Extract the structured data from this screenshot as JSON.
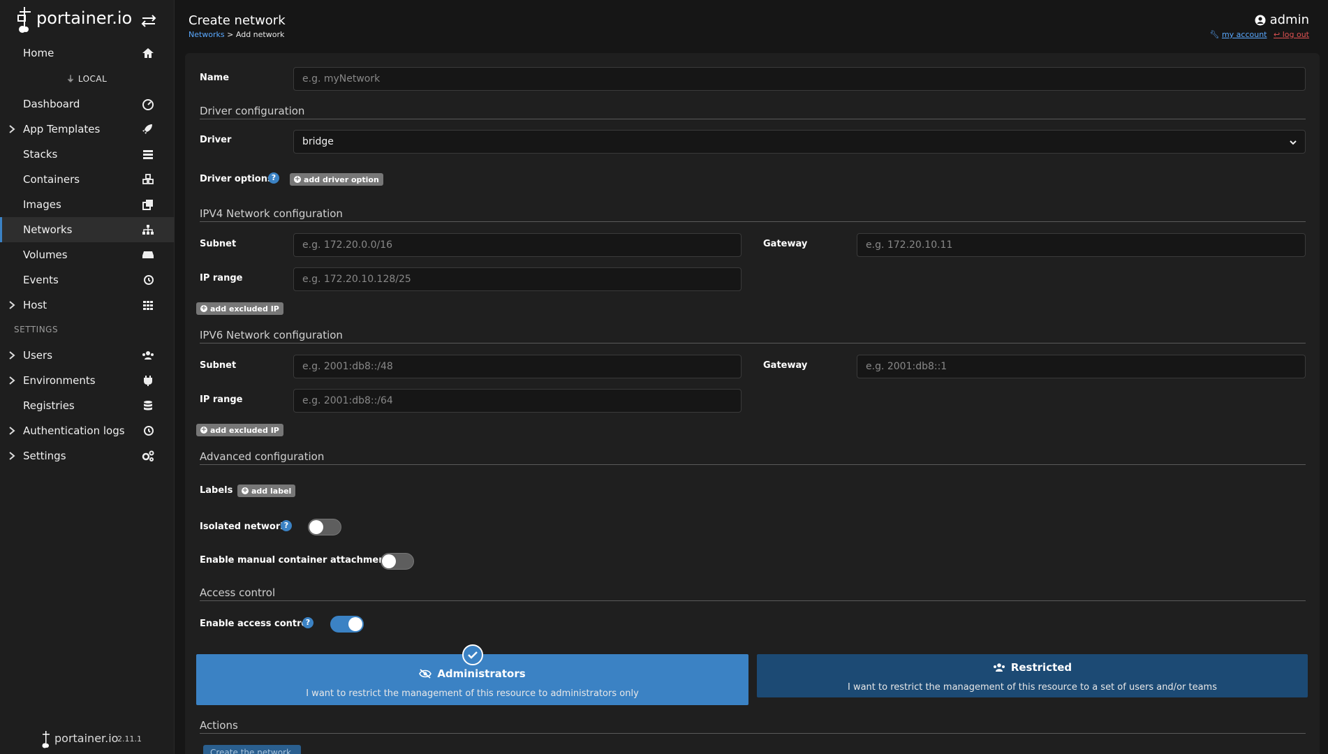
{
  "app": {
    "brand": "portainer.io",
    "version": "2.11.1"
  },
  "sidebar": {
    "environment_label": "LOCAL",
    "settings_heading": "SETTINGS",
    "items": [
      {
        "label": "Home",
        "icon": "home-icon",
        "expandable": false
      },
      {
        "label": "Dashboard",
        "icon": "dashboard-icon",
        "expandable": false
      },
      {
        "label": "App Templates",
        "icon": "rocket-icon",
        "expandable": true
      },
      {
        "label": "Stacks",
        "icon": "list-icon",
        "expandable": false
      },
      {
        "label": "Containers",
        "icon": "cubes-icon",
        "expandable": false
      },
      {
        "label": "Images",
        "icon": "clone-icon",
        "expandable": false
      },
      {
        "label": "Networks",
        "icon": "sitemap-icon",
        "expandable": false,
        "active": true
      },
      {
        "label": "Volumes",
        "icon": "hdd-icon",
        "expandable": false
      },
      {
        "label": "Events",
        "icon": "history-icon",
        "expandable": false
      },
      {
        "label": "Host",
        "icon": "grid-icon",
        "expandable": true
      },
      {
        "label": "Users",
        "icon": "users-icon",
        "expandable": true
      },
      {
        "label": "Environments",
        "icon": "plug-icon",
        "expandable": true
      },
      {
        "label": "Registries",
        "icon": "database-icon",
        "expandable": false
      },
      {
        "label": "Authentication logs",
        "icon": "history-icon",
        "expandable": true
      },
      {
        "label": "Settings",
        "icon": "cogs-icon",
        "expandable": true
      }
    ]
  },
  "header": {
    "title": "Create network",
    "breadcrumb_link": "Networks",
    "breadcrumb_separator": ">",
    "breadcrumb_current": "Add network",
    "user": "admin",
    "my_account": "my account",
    "log_out": "log out"
  },
  "form": {
    "name_label": "Name",
    "name_placeholder": "e.g. myNetwork",
    "driver_section": "Driver configuration",
    "driver_label": "Driver",
    "driver_value": "bridge",
    "driver_options_label": "Driver options",
    "add_driver_option": "add driver option",
    "ipv4_section": "IPV4 Network configuration",
    "ipv4_subnet_label": "Subnet",
    "ipv4_subnet_placeholder": "e.g. 172.20.0.0/16",
    "ipv4_gateway_label": "Gateway",
    "ipv4_gateway_placeholder": "e.g. 172.20.10.11",
    "ipv4_range_label": "IP range",
    "ipv4_range_placeholder": "e.g. 172.20.10.128/25",
    "add_excluded_ip": "add excluded IP",
    "ipv6_section": "IPV6 Network configuration",
    "ipv6_subnet_label": "Subnet",
    "ipv6_subnet_placeholder": "e.g. 2001:db8::/48",
    "ipv6_gateway_label": "Gateway",
    "ipv6_gateway_placeholder": "e.g. 2001:db8::1",
    "ipv6_range_label": "IP range",
    "ipv6_range_placeholder": "e.g. 2001:db8::/64",
    "advanced_section": "Advanced configuration",
    "labels_label": "Labels",
    "add_label": "add label",
    "isolated_label": "Isolated network",
    "isolated_on": false,
    "manual_attach_label": "Enable manual container attachment",
    "manual_attach_on": false,
    "access_section": "Access control",
    "access_label": "Enable access control",
    "access_on": true,
    "admin_title": "Administrators",
    "admin_desc": "I want to restrict the management of this resource to administrators only",
    "restricted_title": "Restricted",
    "restricted_desc": "I want to restrict the management of this resource to a set of users and/or teams",
    "selected_access": "Administrators",
    "actions_section": "Actions",
    "create_button": "Create the network"
  },
  "colors": {
    "accent": "#3b82c4",
    "restricted_bg": "#1c4a74",
    "background": "#161616",
    "sidebar": "#1e1e1e",
    "panel": "#1f1f1f"
  }
}
